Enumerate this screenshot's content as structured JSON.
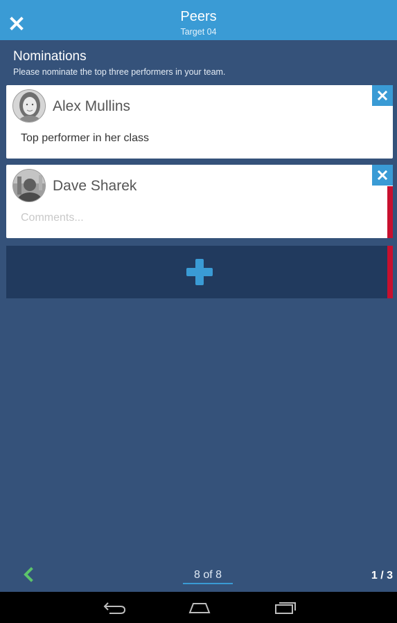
{
  "header": {
    "title": "Peers",
    "subtitle": "Target 04",
    "close_icon": "close-icon"
  },
  "section": {
    "title": "Nominations",
    "instructions": "Please nominate the top three performers in your team."
  },
  "nominations": [
    {
      "name": "Alex Mullins",
      "comment": "Top performer in her class",
      "comment_placeholder": "",
      "flagged": false
    },
    {
      "name": "Dave Sharek",
      "comment": "",
      "comment_placeholder": "Comments...",
      "flagged": true
    }
  ],
  "add_tile": {
    "icon": "plus-icon",
    "flagged": true
  },
  "pager": {
    "position": "8 of 8",
    "page_count": "1 / 3"
  },
  "colors": {
    "accent": "#3a9bd5",
    "background": "#35527a",
    "add_tile": "#213a5e",
    "flag": "#c8102e",
    "back_arrow": "#5cc46a"
  }
}
